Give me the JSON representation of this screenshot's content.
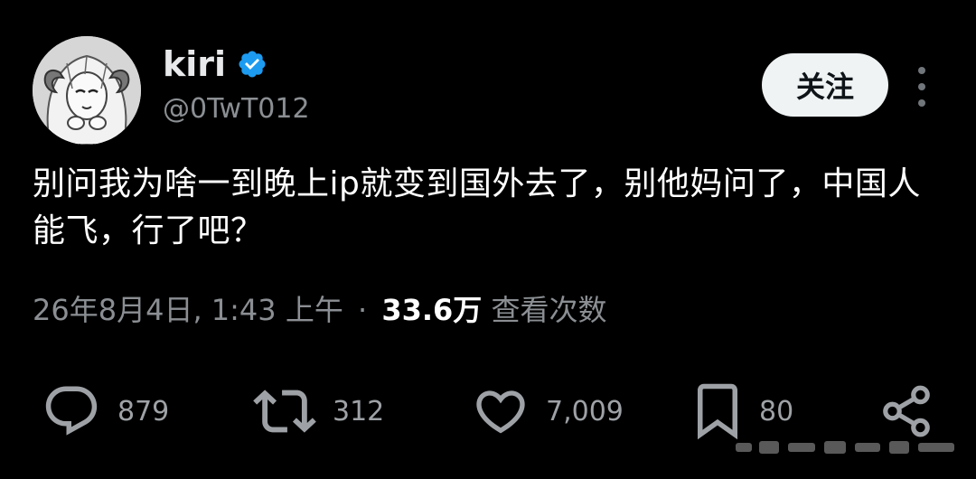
{
  "user": {
    "display_name": "kiri",
    "handle": "@0TwT012",
    "verified": true,
    "avatar": "avatar-illustration"
  },
  "header": {
    "follow_label": "关注",
    "more_icon": "more-vertical-icon"
  },
  "tweet": {
    "text": "别问我为啥一到晚上ip就变到国外去了，别他妈问了，中国人能飞，行了吧？",
    "timestamp": "26年8月4日, 1:43 上午",
    "separator": "·",
    "views_count": "33.6万",
    "views_label": "查看次数"
  },
  "actions": {
    "reply": {
      "icon": "reply-icon",
      "count": "879"
    },
    "retweet": {
      "icon": "retweet-icon",
      "count": "312"
    },
    "like": {
      "icon": "heart-icon",
      "count": "7,009"
    },
    "bookmark": {
      "icon": "bookmark-icon",
      "count": "80"
    },
    "share": {
      "icon": "share-icon"
    }
  },
  "colors": {
    "background": "#000000",
    "text_primary": "#ffffff",
    "text_secondary": "#8b8f93",
    "verified_badge": "#1d9bf0",
    "follow_button_bg": "#eff3f4"
  }
}
